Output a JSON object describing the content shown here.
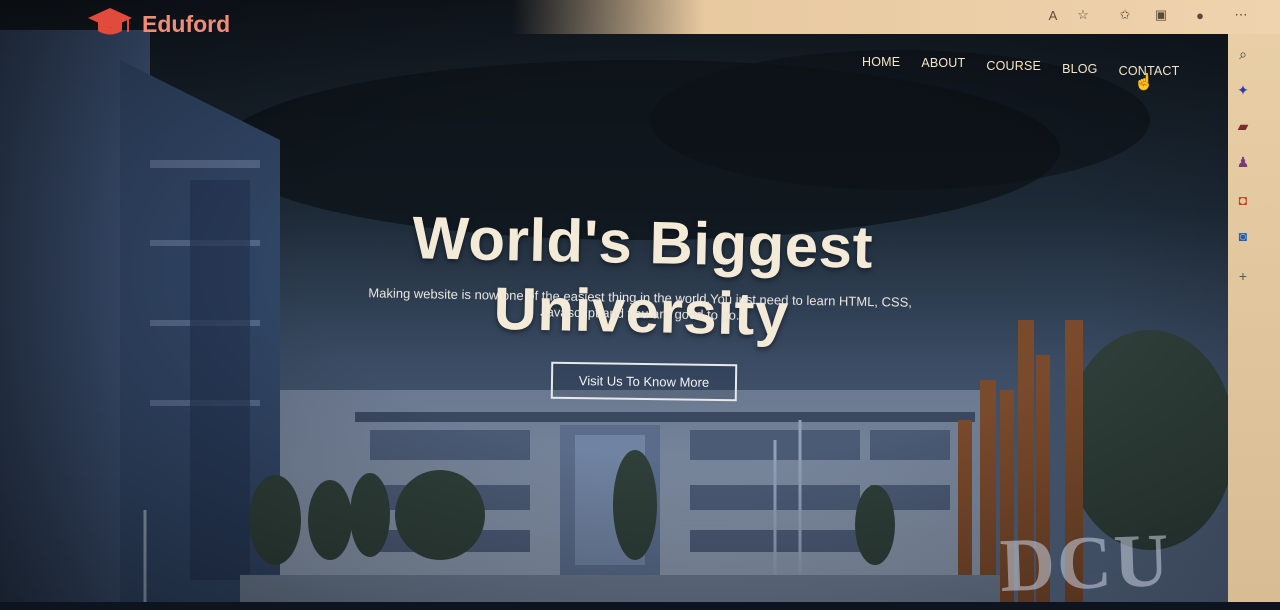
{
  "brand": {
    "name": "Eduford",
    "logo_icon": "graduation-cap-icon",
    "accent": "#f18c7a"
  },
  "nav": {
    "items": [
      {
        "label": "HOME"
      },
      {
        "label": "ABOUT"
      },
      {
        "label": "COURSE"
      },
      {
        "label": "BLOG"
      },
      {
        "label": "CONTACT"
      }
    ]
  },
  "hero": {
    "title": "World's Biggest University",
    "subtitle": "Making website is now one of the easiest thing in the world.You just need to learn HTML, CSS, Javascript and you are good to go.",
    "cta_label": "Visit Us To Know More"
  },
  "scene": {
    "signage": "DCU"
  },
  "browser": {
    "top_icons": [
      "read-aloud-icon",
      "favorite-add-icon",
      "favorites-icon",
      "collections-icon",
      "profile-avatar-icon",
      "more-icon"
    ],
    "sidebar_icons": [
      "search-icon",
      "copilot-icon",
      "shopping-icon",
      "games-icon",
      "office-icon",
      "outlook-icon",
      "add-icon"
    ]
  }
}
